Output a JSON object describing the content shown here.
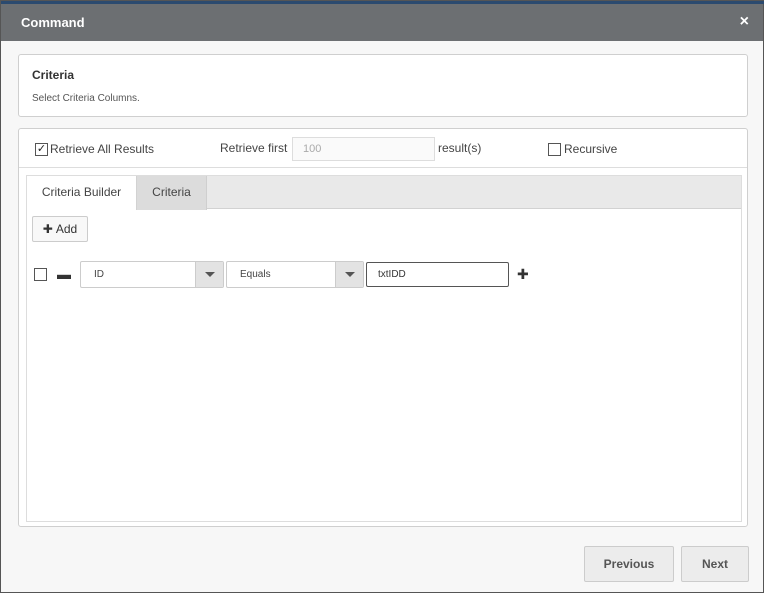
{
  "dialog": {
    "title": "Command",
    "close_symbol": "×"
  },
  "criteria_panel": {
    "heading": "Criteria",
    "subtitle": "Select Criteria Columns."
  },
  "options": {
    "retrieve_all_checked": true,
    "retrieve_all_label": "Retrieve All Results",
    "retrieve_first_label": "Retrieve first",
    "retrieve_first_placeholder": "100",
    "results_label": "result(s)",
    "recursive_checked": false,
    "recursive_label": "Recursive"
  },
  "tabs": [
    {
      "label": "Criteria Builder",
      "active": true
    },
    {
      "label": "Criteria",
      "active": false
    }
  ],
  "builder": {
    "add_label": "Add",
    "rows": [
      {
        "checked": false,
        "field": "ID",
        "operator": "Equals",
        "value": "txtIDD"
      }
    ]
  },
  "footer": {
    "previous_label": "Previous",
    "next_label": "Next"
  },
  "icons": {
    "close": "close-icon",
    "checkbox": "checkbox-icon",
    "add": "plus-icon",
    "remove_row": "minus-icon",
    "dropdown": "chevron-down-icon",
    "add_row": "plus-icon"
  }
}
